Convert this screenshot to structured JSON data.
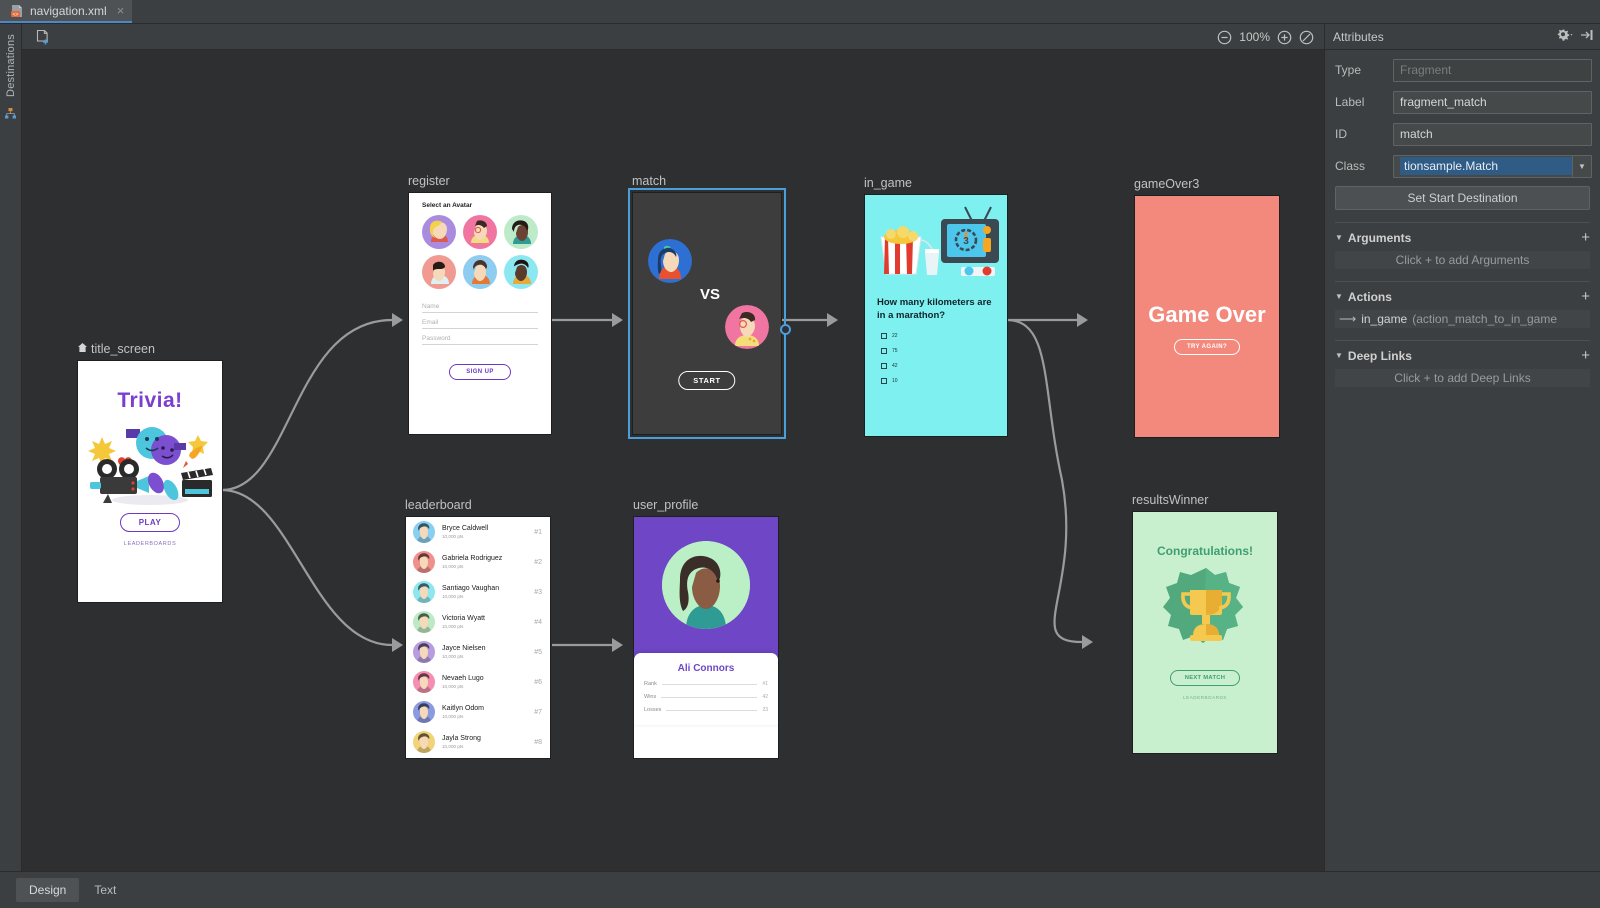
{
  "tab": {
    "title": "navigation.xml",
    "close_label": "×",
    "icon": "xml-file-icon"
  },
  "left_strip": {
    "label": "Destinations",
    "icon": "hierarchy-icon"
  },
  "toolbar": {
    "new_destination_icon": "new-destination-icon",
    "zoom_out_icon": "zoom-out-icon",
    "zoom_level": "100%",
    "zoom_in_icon": "zoom-in-icon",
    "zoom_fit_icon": "zoom-fit-icon",
    "issues_icon": "issues-icon"
  },
  "attributes": {
    "title": "Attributes",
    "gear_icon": "gear-dropdown-icon",
    "collapse_icon": "collapse-panel-icon",
    "rows": [
      {
        "label": "Type",
        "value": "Fragment",
        "disabled": true
      },
      {
        "label": "Label",
        "value": "fragment_match",
        "disabled": false
      },
      {
        "label": "ID",
        "value": "match",
        "disabled": false
      }
    ],
    "class_row": {
      "label": "Class",
      "value": "tionsample.Match",
      "arrow": "▼"
    },
    "set_start_destination": "Set Start Destination",
    "sections": [
      {
        "caret": "▼",
        "title": "Arguments",
        "plus": "+",
        "empty": "Click + to add Arguments"
      },
      {
        "caret": "▼",
        "title": "Actions",
        "plus": "+",
        "empty": null,
        "items": [
          {
            "icon": "arrow-right-icon",
            "name": "in_game",
            "id": "(action_match_to_in_game"
          }
        ]
      },
      {
        "caret": "▼",
        "title": "Deep Links",
        "plus": "+",
        "empty": "Click + to add Deep Links"
      }
    ]
  },
  "bottom_tabs": [
    {
      "label": "Design",
      "active": true
    },
    {
      "label": "Text",
      "active": false
    }
  ],
  "destinations": {
    "title_screen": {
      "label": "title_screen",
      "is_start": true,
      "start_icon": "home-icon",
      "title": "Trivia!",
      "play_button": "PLAY",
      "leaderboards_link": "LEADERBOARDS",
      "bg": "#ffffff",
      "title_color": "#7b3fcf"
    },
    "register": {
      "label": "register",
      "heading": "Select an Avatar",
      "fields": [
        "Name",
        "Email",
        "Password"
      ],
      "signup_button": "SIGN UP"
    },
    "match": {
      "label": "match",
      "selected": true,
      "vs_text": "VS",
      "start_button": "START",
      "bg": "#3d3d3d",
      "selection_color": "#4a9eda"
    },
    "in_game": {
      "label": "in_game",
      "question": "How many kilometers are in a marathon?",
      "options": [
        "22",
        "75",
        "42",
        "10"
      ],
      "bg": "#7ef0f0"
    },
    "gameOver3": {
      "label": "gameOver3",
      "title": "Game Over",
      "button": "TRY AGAIN?",
      "bg": "#f3887d"
    },
    "leaderboard": {
      "label": "leaderboard",
      "rows": [
        {
          "name": "Bryce Caldwell",
          "points": "10,000 pts",
          "rank": "#1",
          "av": "#89cff0"
        },
        {
          "name": "Gabriela Rodriguez",
          "points": "10,000 pts",
          "rank": "#2",
          "av": "#f0908c"
        },
        {
          "name": "Santiago Vaughan",
          "points": "10,000 pts",
          "rank": "#3",
          "av": "#8ee7ef"
        },
        {
          "name": "Victoria Wyatt",
          "points": "10,000 pts",
          "rank": "#4",
          "av": "#bde9c4"
        },
        {
          "name": "Jayce Nielsen",
          "points": "10,000 pts",
          "rank": "#5",
          "av": "#b79de0"
        },
        {
          "name": "Nevaeh Lugo",
          "points": "10,000 pts",
          "rank": "#6",
          "av": "#f48fb1"
        },
        {
          "name": "Kaitlyn Odom",
          "points": "10,000 pts",
          "rank": "#7",
          "av": "#8c9ae0"
        },
        {
          "name": "Jayla Strong",
          "points": "10,000 pts",
          "rank": "#8",
          "av": "#f2d27a"
        }
      ]
    },
    "user_profile": {
      "label": "user_profile",
      "name": "Ali Connors",
      "header_bg": "#6f46c6",
      "stats": [
        {
          "label": "Rank",
          "value": "#1"
        },
        {
          "label": "Wins",
          "value": "42"
        },
        {
          "label": "Losses",
          "value": "23"
        }
      ]
    },
    "resultsWinner": {
      "label": "resultsWinner",
      "title": "Congratulations!",
      "button": "NEXT MATCH",
      "leaderboards_link": "LEADERBOARDS",
      "bg": "#c8f0ce"
    }
  }
}
